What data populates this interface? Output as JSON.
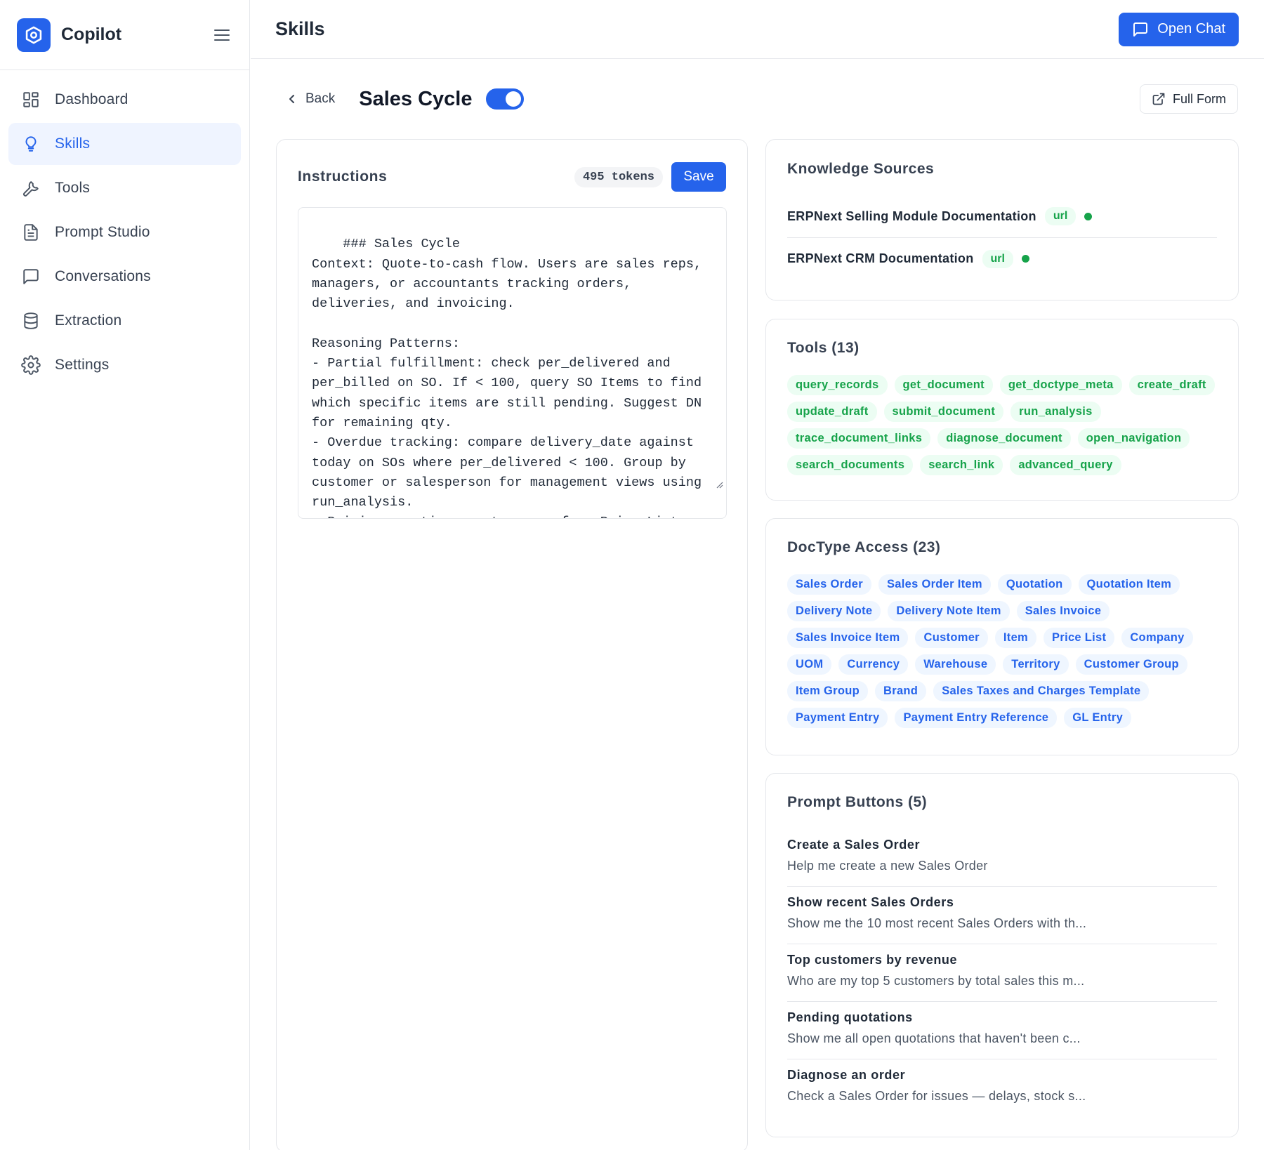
{
  "app": {
    "name": "Copilot"
  },
  "sidebar": {
    "items": [
      {
        "label": "Dashboard",
        "icon": "dashboard-icon"
      },
      {
        "label": "Skills",
        "icon": "lightbulb-icon",
        "active": true
      },
      {
        "label": "Tools",
        "icon": "wrench-icon"
      },
      {
        "label": "Prompt Studio",
        "icon": "document-icon"
      },
      {
        "label": "Conversations",
        "icon": "chat-icon"
      },
      {
        "label": "Extraction",
        "icon": "database-icon"
      },
      {
        "label": "Settings",
        "icon": "gear-icon"
      }
    ]
  },
  "header": {
    "title": "Skills",
    "open_chat_label": "Open Chat"
  },
  "subheader": {
    "back_label": "Back",
    "skill_name": "Sales Cycle",
    "enabled": true,
    "full_form_label": "Full Form"
  },
  "instructions": {
    "title": "Instructions",
    "tokens": "495 tokens",
    "save_label": "Save",
    "text": "### Sales Cycle\nContext: Quote-to-cash flow. Users are sales reps, managers, or accountants tracking orders, deliveries, and invoicing.\n\nReasoning Patterns:\n- Partial fulfillment: check per_delivered and per_billed on SO. If < 100, query SO Items to find which specific items are still pending. Suggest DN for remaining qty.\n- Overdue tracking: compare delivery_date against today on SOs where per_delivered < 100. Group by customer or salesperson for management views using run_analysis.\n- Pricing questions: rate comes from Price List"
  },
  "knowledge_sources": {
    "title": "Knowledge Sources",
    "items": [
      {
        "name": "ERPNext Selling Module Documentation",
        "type": "url"
      },
      {
        "name": "ERPNext CRM Documentation",
        "type": "url"
      }
    ]
  },
  "tools": {
    "title": "Tools (13)",
    "items": [
      "query_records",
      "get_document",
      "get_doctype_meta",
      "create_draft",
      "update_draft",
      "submit_document",
      "run_analysis",
      "trace_document_links",
      "diagnose_document",
      "open_navigation",
      "search_documents",
      "search_link",
      "advanced_query"
    ]
  },
  "doctype_access": {
    "title": "DocType Access (23)",
    "items": [
      "Sales Order",
      "Sales Order Item",
      "Quotation",
      "Quotation Item",
      "Delivery Note",
      "Delivery Note Item",
      "Sales Invoice",
      "Sales Invoice Item",
      "Customer",
      "Item",
      "Price List",
      "Company",
      "UOM",
      "Currency",
      "Warehouse",
      "Territory",
      "Customer Group",
      "Item Group",
      "Brand",
      "Sales Taxes and Charges Template",
      "Payment Entry",
      "Payment Entry Reference",
      "GL Entry"
    ]
  },
  "prompt_buttons": {
    "title": "Prompt Buttons (5)",
    "items": [
      {
        "label": "Create a Sales Order",
        "description": "Help me create a new Sales Order"
      },
      {
        "label": "Show recent Sales Orders",
        "description": "Show me the 10 most recent Sales Orders with th..."
      },
      {
        "label": "Top customers by revenue",
        "description": "Who are my top 5 customers by total sales this m..."
      },
      {
        "label": "Pending quotations",
        "description": "Show me all open quotations that haven't been c..."
      },
      {
        "label": "Diagnose an order",
        "description": "Check a Sales Order for issues — delays, stock s..."
      }
    ]
  },
  "colors": {
    "accent": "#2563eb",
    "success": "#16a34a",
    "border": "#e5e7eb"
  }
}
